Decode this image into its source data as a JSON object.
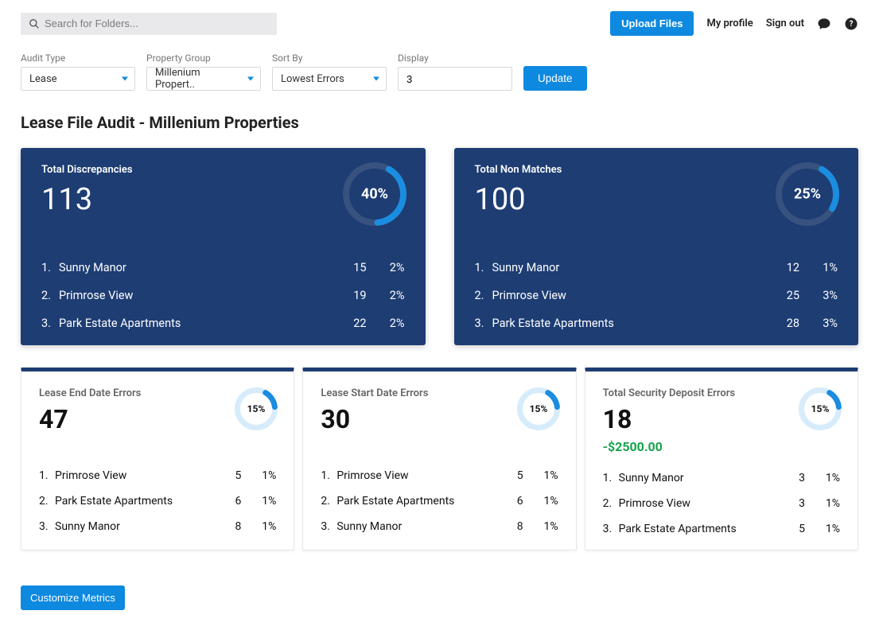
{
  "topbar": {
    "search_placeholder": "Search for Folders...",
    "upload_label": "Upload Files",
    "profile_label": "My profile",
    "signout_label": "Sign out"
  },
  "filters": {
    "audit_type": {
      "label": "Audit Type",
      "value": "Lease"
    },
    "property_group": {
      "label": "Property Group",
      "value": "Millenium Propert.."
    },
    "sort_by": {
      "label": "Sort By",
      "value": "Lowest Errors"
    },
    "display": {
      "label": "Display",
      "value": "3"
    },
    "update_label": "Update"
  },
  "page_title": "Lease File Audit - Millenium Properties",
  "big_cards": [
    {
      "title": "Total Discrepancies",
      "value": "113",
      "pct": "40%",
      "donut_frac": 0.4,
      "rows": [
        {
          "idx": "1.",
          "name": "Sunny Manor",
          "count": "15",
          "pct": "2%"
        },
        {
          "idx": "2.",
          "name": "Primrose View",
          "count": "19",
          "pct": "2%"
        },
        {
          "idx": "3.",
          "name": "Park Estate Apartments",
          "count": "22",
          "pct": "2%"
        }
      ]
    },
    {
      "title": "Total Non Matches",
      "value": "100",
      "pct": "25%",
      "donut_frac": 0.25,
      "rows": [
        {
          "idx": "1.",
          "name": "Sunny Manor",
          "count": "12",
          "pct": "1%"
        },
        {
          "idx": "2.",
          "name": "Primrose View",
          "count": "25",
          "pct": "3%"
        },
        {
          "idx": "3.",
          "name": "Park Estate Apartments",
          "count": "28",
          "pct": "3%"
        }
      ]
    }
  ],
  "small_cards": [
    {
      "title": "Lease End Date Errors",
      "value": "47",
      "pct": "15%",
      "donut_frac": 0.15,
      "sub": "",
      "rows": [
        {
          "idx": "1.",
          "name": "Primrose View",
          "count": "5",
          "pct": "1%"
        },
        {
          "idx": "2.",
          "name": "Park Estate Apartments",
          "count": "6",
          "pct": "1%"
        },
        {
          "idx": "3.",
          "name": "Sunny Manor",
          "count": "8",
          "pct": "1%"
        }
      ]
    },
    {
      "title": "Lease Start Date Errors",
      "value": "30",
      "pct": "15%",
      "donut_frac": 0.15,
      "sub": "",
      "rows": [
        {
          "idx": "1.",
          "name": "Primrose View",
          "count": "5",
          "pct": "1%"
        },
        {
          "idx": "2.",
          "name": "Park Estate Apartments",
          "count": "6",
          "pct": "1%"
        },
        {
          "idx": "3.",
          "name": "Sunny Manor",
          "count": "8",
          "pct": "1%"
        }
      ]
    },
    {
      "title": "Total Security Deposit Errors",
      "value": "18",
      "pct": "15%",
      "donut_frac": 0.15,
      "sub": "-$2500.00",
      "rows": [
        {
          "idx": "1.",
          "name": "Sunny Manor",
          "count": "3",
          "pct": "1%"
        },
        {
          "idx": "2.",
          "name": "Primrose View",
          "count": "3",
          "pct": "1%"
        },
        {
          "idx": "3.",
          "name": "Park Estate Apartments",
          "count": "5",
          "pct": "1%"
        }
      ]
    }
  ],
  "footer": {
    "customize_label": "Customize Metrics"
  },
  "chart_data": [
    {
      "type": "pie",
      "title": "Total Discrepancies",
      "total": 113,
      "pct": 40
    },
    {
      "type": "pie",
      "title": "Total Non Matches",
      "total": 100,
      "pct": 25
    },
    {
      "type": "pie",
      "title": "Lease End Date Errors",
      "total": 47,
      "pct": 15
    },
    {
      "type": "pie",
      "title": "Lease Start Date Errors",
      "total": 30,
      "pct": 15
    },
    {
      "type": "pie",
      "title": "Total Security Deposit Errors",
      "total": 18,
      "pct": 15
    }
  ]
}
